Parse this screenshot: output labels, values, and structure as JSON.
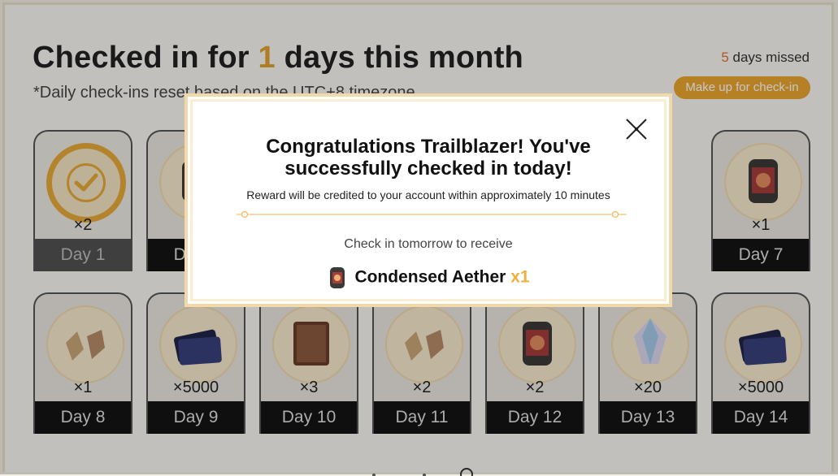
{
  "header": {
    "prefix": "Checked in for ",
    "days_count": "1",
    "suffix": " days this month",
    "note": "*Daily check-ins reset based on the UTC+8 timezone",
    "missed_count": "5",
    "missed_label": " days missed",
    "makeup_label": "Make up for check-in"
  },
  "cards": [
    {
      "day": "Day 1",
      "qty": "×2",
      "icon": "checked-badge-icon"
    },
    {
      "day": "Day 2",
      "qty": "",
      "icon": "condensed-aether-icon"
    },
    {
      "day": "Day 7",
      "qty": "×1",
      "icon": "condensed-aether-icon"
    },
    {
      "day": "Day 8",
      "qty": "×1",
      "icon": "relic-remains-icon"
    },
    {
      "day": "Day 9",
      "qty": "×5000",
      "icon": "credit-card-icon"
    },
    {
      "day": "Day 10",
      "qty": "×3",
      "icon": "book-icon"
    },
    {
      "day": "Day 11",
      "qty": "×2",
      "icon": "relic-remains-icon"
    },
    {
      "day": "Day 12",
      "qty": "×2",
      "icon": "condensed-aether-icon"
    },
    {
      "day": "Day 13",
      "qty": "×20",
      "icon": "stellar-jade-icon"
    },
    {
      "day": "Day 14",
      "qty": "×5000",
      "icon": "credit-card-icon"
    }
  ],
  "modal": {
    "title": "Congratulations Trailblazer! You've successfully checked in today!",
    "subtitle": "Reward will be credited to your account within approximately 10 minutes",
    "tomorrow_label": "Check in tomorrow to receive",
    "reward_name": "Condensed Aether",
    "reward_qty": "x1"
  }
}
